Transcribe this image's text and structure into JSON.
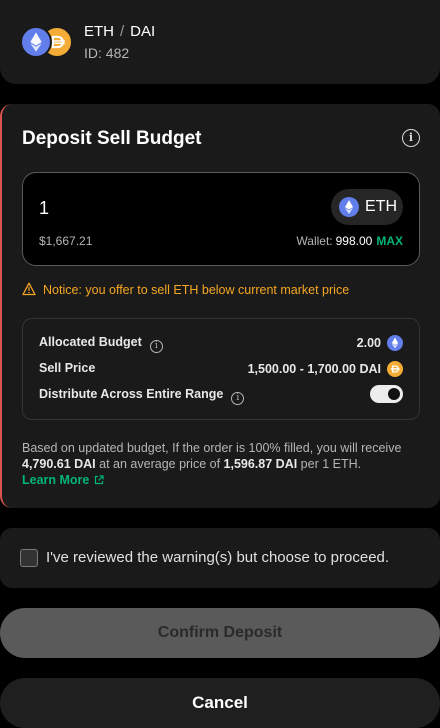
{
  "pair": {
    "base": "ETH",
    "separator": "/",
    "quote": "DAI",
    "id_label": "ID: 482",
    "base_icon": "eth-token-icon",
    "quote_icon": "dai-token-icon"
  },
  "budget": {
    "title": "Deposit Sell Budget",
    "amount_value": "1",
    "token": "ETH",
    "usd_value": "$1,667.21",
    "wallet_label": "Wallet:",
    "wallet_value": "998.00",
    "max_label": "MAX",
    "notice": "Notice: you offer to sell ETH below current market price"
  },
  "details": {
    "allocated_label": "Allocated Budget",
    "allocated_value": "2.00",
    "sell_price_label": "Sell Price",
    "sell_price_value": "1,500.00 - 1,700.00 DAI",
    "distribute_label": "Distribute Across Entire Range",
    "distribute_on": true
  },
  "summary": {
    "text_1": "Based on updated budget, If the order is 100% filled, you will receive ",
    "receive_amount": "4,790.61 DAI",
    "text_2": " at an average price of ",
    "avg_price": "1,596.87 DAI",
    "text_3": " per 1 ETH.",
    "learn_more": "Learn More"
  },
  "warning": {
    "checkbox_label": "I've reviewed the warning(s) but choose to proceed.",
    "checked": false
  },
  "actions": {
    "confirm_label": "Confirm Deposit",
    "cancel_label": "Cancel"
  },
  "colors": {
    "accent_green": "#00b578",
    "notice_orange": "#f5a623",
    "warning_border": "#d9534f",
    "eth_blue": "#627eea",
    "dai_yellow": "#f5ac37"
  }
}
